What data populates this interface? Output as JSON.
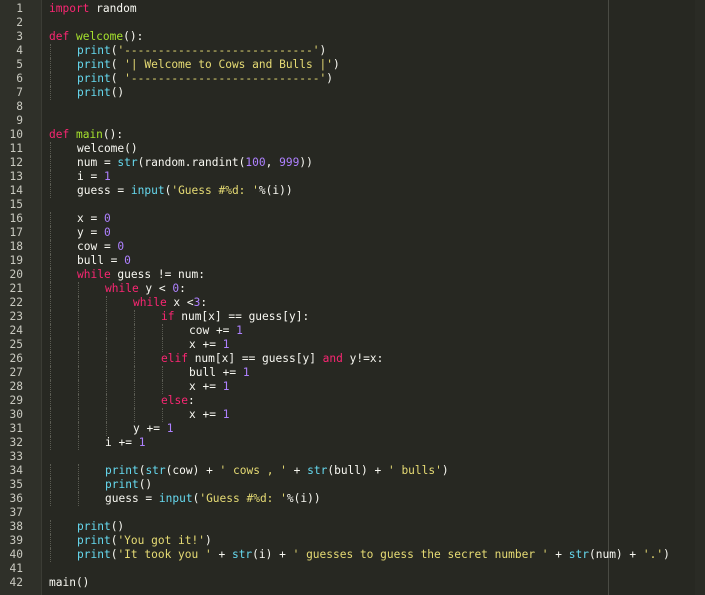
{
  "editor": {
    "language": "python",
    "colors": {
      "background": "#272822",
      "keyword": "#f92672",
      "function": "#a6e22e",
      "builtin": "#66d9ef",
      "string": "#e6db74",
      "number": "#ae81ff",
      "text": "#f8f8f2"
    },
    "lines": [
      {
        "n": "1",
        "indent": 0,
        "tokens": [
          {
            "t": "import",
            "c": "kw"
          },
          {
            "t": " random",
            "c": "op"
          }
        ]
      },
      {
        "n": "2",
        "indent": 0,
        "tokens": []
      },
      {
        "n": "3",
        "indent": 0,
        "tokens": [
          {
            "t": "def",
            "c": "kw"
          },
          {
            "t": " ",
            "c": "op"
          },
          {
            "t": "welcome",
            "c": "fn"
          },
          {
            "t": "():",
            "c": "op"
          }
        ]
      },
      {
        "n": "4",
        "indent": 1,
        "tokens": [
          {
            "t": "print",
            "c": "bi"
          },
          {
            "t": "(",
            "c": "op"
          },
          {
            "t": "'----------------------------'",
            "c": "st"
          },
          {
            "t": ")",
            "c": "op"
          }
        ]
      },
      {
        "n": "5",
        "indent": 1,
        "tokens": [
          {
            "t": "print",
            "c": "bi"
          },
          {
            "t": "( ",
            "c": "op"
          },
          {
            "t": "'| Welcome to Cows and Bulls |'",
            "c": "st"
          },
          {
            "t": ")",
            "c": "op"
          }
        ]
      },
      {
        "n": "6",
        "indent": 1,
        "tokens": [
          {
            "t": "print",
            "c": "bi"
          },
          {
            "t": "( ",
            "c": "op"
          },
          {
            "t": "'----------------------------'",
            "c": "st"
          },
          {
            "t": ")",
            "c": "op"
          }
        ]
      },
      {
        "n": "7",
        "indent": 1,
        "tokens": [
          {
            "t": "print",
            "c": "bi"
          },
          {
            "t": "()",
            "c": "op"
          }
        ]
      },
      {
        "n": "8",
        "indent": 0,
        "tokens": []
      },
      {
        "n": "9",
        "indent": 0,
        "tokens": []
      },
      {
        "n": "10",
        "indent": 0,
        "tokens": [
          {
            "t": "def",
            "c": "kw"
          },
          {
            "t": " ",
            "c": "op"
          },
          {
            "t": "main",
            "c": "fn"
          },
          {
            "t": "():",
            "c": "op"
          }
        ]
      },
      {
        "n": "11",
        "indent": 1,
        "tokens": [
          {
            "t": "welcome()",
            "c": "op"
          }
        ]
      },
      {
        "n": "12",
        "indent": 1,
        "tokens": [
          {
            "t": "num = ",
            "c": "op"
          },
          {
            "t": "str",
            "c": "bi"
          },
          {
            "t": "(random.randint(",
            "c": "op"
          },
          {
            "t": "100",
            "c": "nu"
          },
          {
            "t": ", ",
            "c": "op"
          },
          {
            "t": "999",
            "c": "nu"
          },
          {
            "t": "))",
            "c": "op"
          }
        ]
      },
      {
        "n": "13",
        "indent": 1,
        "tokens": [
          {
            "t": "i = ",
            "c": "op"
          },
          {
            "t": "1",
            "c": "nu"
          }
        ]
      },
      {
        "n": "14",
        "indent": 1,
        "tokens": [
          {
            "t": "guess = ",
            "c": "op"
          },
          {
            "t": "input",
            "c": "bi"
          },
          {
            "t": "(",
            "c": "op"
          },
          {
            "t": "'Guess #%d: '",
            "c": "st"
          },
          {
            "t": "%(i))",
            "c": "op"
          }
        ]
      },
      {
        "n": "15",
        "indent": 0,
        "tokens": []
      },
      {
        "n": "16",
        "indent": 1,
        "tokens": [
          {
            "t": "x = ",
            "c": "op"
          },
          {
            "t": "0",
            "c": "nu"
          }
        ]
      },
      {
        "n": "17",
        "indent": 1,
        "tokens": [
          {
            "t": "y = ",
            "c": "op"
          },
          {
            "t": "0",
            "c": "nu"
          }
        ]
      },
      {
        "n": "18",
        "indent": 1,
        "tokens": [
          {
            "t": "cow = ",
            "c": "op"
          },
          {
            "t": "0",
            "c": "nu"
          }
        ]
      },
      {
        "n": "19",
        "indent": 1,
        "tokens": [
          {
            "t": "bull = ",
            "c": "op"
          },
          {
            "t": "0",
            "c": "nu"
          }
        ]
      },
      {
        "n": "20",
        "indent": 1,
        "tokens": [
          {
            "t": "while",
            "c": "kw"
          },
          {
            "t": " guess != num:",
            "c": "op"
          }
        ]
      },
      {
        "n": "21",
        "indent": 2,
        "tokens": [
          {
            "t": "while",
            "c": "kw"
          },
          {
            "t": " y < ",
            "c": "op"
          },
          {
            "t": "0",
            "c": "nu"
          },
          {
            "t": ":",
            "c": "op"
          }
        ]
      },
      {
        "n": "22",
        "indent": 3,
        "tokens": [
          {
            "t": "while",
            "c": "kw"
          },
          {
            "t": " x <",
            "c": "op"
          },
          {
            "t": "3",
            "c": "nu"
          },
          {
            "t": ":",
            "c": "op"
          }
        ]
      },
      {
        "n": "23",
        "indent": 4,
        "tokens": [
          {
            "t": "if",
            "c": "kw"
          },
          {
            "t": " num[x] == guess[y]:",
            "c": "op"
          }
        ]
      },
      {
        "n": "24",
        "indent": 5,
        "tokens": [
          {
            "t": "cow += ",
            "c": "op"
          },
          {
            "t": "1",
            "c": "nu"
          }
        ]
      },
      {
        "n": "25",
        "indent": 5,
        "tokens": [
          {
            "t": "x += ",
            "c": "op"
          },
          {
            "t": "1",
            "c": "nu"
          }
        ]
      },
      {
        "n": "26",
        "indent": 4,
        "tokens": [
          {
            "t": "elif",
            "c": "kw"
          },
          {
            "t": " num[x] == guess[y] ",
            "c": "op"
          },
          {
            "t": "and",
            "c": "kw"
          },
          {
            "t": " y!=x:",
            "c": "op"
          }
        ]
      },
      {
        "n": "27",
        "indent": 5,
        "tokens": [
          {
            "t": "bull += ",
            "c": "op"
          },
          {
            "t": "1",
            "c": "nu"
          }
        ]
      },
      {
        "n": "28",
        "indent": 5,
        "tokens": [
          {
            "t": "x += ",
            "c": "op"
          },
          {
            "t": "1",
            "c": "nu"
          }
        ]
      },
      {
        "n": "29",
        "indent": 4,
        "tokens": [
          {
            "t": "else",
            "c": "kw"
          },
          {
            "t": ":",
            "c": "op"
          }
        ]
      },
      {
        "n": "30",
        "indent": 5,
        "tokens": [
          {
            "t": "x += ",
            "c": "op"
          },
          {
            "t": "1",
            "c": "nu"
          }
        ]
      },
      {
        "n": "31",
        "indent": 3,
        "tokens": [
          {
            "t": "y += ",
            "c": "op"
          },
          {
            "t": "1",
            "c": "nu"
          }
        ]
      },
      {
        "n": "32",
        "indent": 2,
        "tokens": [
          {
            "t": "i += ",
            "c": "op"
          },
          {
            "t": "1",
            "c": "nu"
          }
        ]
      },
      {
        "n": "33",
        "indent": 0,
        "tokens": []
      },
      {
        "n": "34",
        "indent": 2,
        "tokens": [
          {
            "t": "print",
            "c": "bi"
          },
          {
            "t": "(",
            "c": "op"
          },
          {
            "t": "str",
            "c": "bi"
          },
          {
            "t": "(cow) + ",
            "c": "op"
          },
          {
            "t": "' cows , '",
            "c": "st"
          },
          {
            "t": " + ",
            "c": "op"
          },
          {
            "t": "str",
            "c": "bi"
          },
          {
            "t": "(bull) + ",
            "c": "op"
          },
          {
            "t": "' bulls'",
            "c": "st"
          },
          {
            "t": ")",
            "c": "op"
          }
        ]
      },
      {
        "n": "35",
        "indent": 2,
        "tokens": [
          {
            "t": "print",
            "c": "bi"
          },
          {
            "t": "()",
            "c": "op"
          }
        ]
      },
      {
        "n": "36",
        "indent": 2,
        "tokens": [
          {
            "t": "guess = ",
            "c": "op"
          },
          {
            "t": "input",
            "c": "bi"
          },
          {
            "t": "(",
            "c": "op"
          },
          {
            "t": "'Guess #%d: '",
            "c": "st"
          },
          {
            "t": "%(i))",
            "c": "op"
          }
        ]
      },
      {
        "n": "37",
        "indent": 0,
        "tokens": []
      },
      {
        "n": "38",
        "indent": 1,
        "tokens": [
          {
            "t": "print",
            "c": "bi"
          },
          {
            "t": "()",
            "c": "op"
          }
        ]
      },
      {
        "n": "39",
        "indent": 1,
        "tokens": [
          {
            "t": "print",
            "c": "bi"
          },
          {
            "t": "(",
            "c": "op"
          },
          {
            "t": "'You got it!'",
            "c": "st"
          },
          {
            "t": ")",
            "c": "op"
          }
        ]
      },
      {
        "n": "40",
        "indent": 1,
        "tokens": [
          {
            "t": "print",
            "c": "bi"
          },
          {
            "t": "(",
            "c": "op"
          },
          {
            "t": "'It took you '",
            "c": "st"
          },
          {
            "t": " + ",
            "c": "op"
          },
          {
            "t": "str",
            "c": "bi"
          },
          {
            "t": "(i) + ",
            "c": "op"
          },
          {
            "t": "' guesses to guess the secret number '",
            "c": "st"
          },
          {
            "t": " + ",
            "c": "op"
          },
          {
            "t": "str",
            "c": "bi"
          },
          {
            "t": "(num) + ",
            "c": "op"
          },
          {
            "t": "'.'",
            "c": "st"
          },
          {
            "t": ")",
            "c": "op"
          }
        ]
      },
      {
        "n": "41",
        "indent": 0,
        "tokens": []
      },
      {
        "n": "42",
        "indent": 0,
        "tokens": [
          {
            "t": "main()",
            "c": "op"
          }
        ]
      }
    ]
  }
}
